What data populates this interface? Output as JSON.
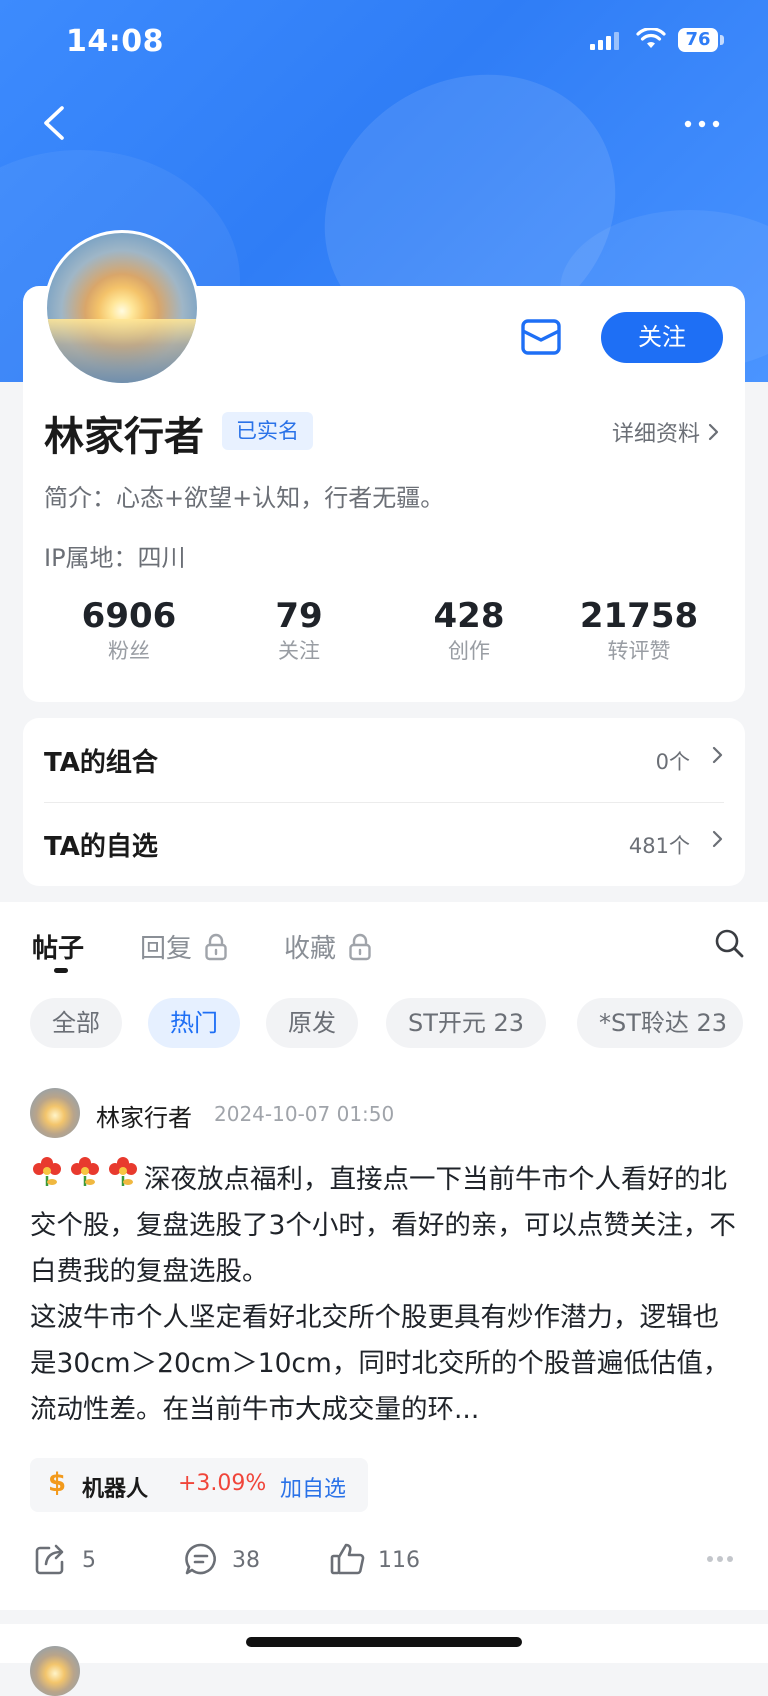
{
  "status_bar": {
    "time": "14:08",
    "battery": "76"
  },
  "profile": {
    "name": "林家行者",
    "verified_badge": "已实名",
    "detail_link": "详细资料",
    "bio": "简介：心态+欲望+认知，行者无疆。",
    "ip": "IP属地：四川",
    "follow_label": "关注",
    "stats": [
      {
        "value": "6906",
        "label": "粉丝"
      },
      {
        "value": "79",
        "label": "关注"
      },
      {
        "value": "428",
        "label": "创作"
      },
      {
        "value": "21758",
        "label": "转评赞"
      }
    ]
  },
  "lists": [
    {
      "title": "TA的组合",
      "count": "0个"
    },
    {
      "title": "TA的自选",
      "count": "481个"
    }
  ],
  "tabs": [
    {
      "label": "帖子",
      "locked": false,
      "active": true
    },
    {
      "label": "回复",
      "locked": true,
      "active": false
    },
    {
      "label": "收藏",
      "locked": true,
      "active": false
    }
  ],
  "filters": [
    {
      "label": "全部",
      "active": false
    },
    {
      "label": "热门",
      "active": true
    },
    {
      "label": "原发",
      "active": false
    },
    {
      "label": "ST开元 23",
      "active": false
    },
    {
      "label": "*ST聆达 23",
      "active": false
    }
  ],
  "post": {
    "author": "林家行者",
    "time": "2024-10-07 01:50",
    "body_line1": "深夜放点福利，直接点一下当前牛市个人看",
    "body_rest": "好的北交个股，复盘选股了3个小时，看好的亲，可以点赞关注，不白费我的复盘选股。",
    "body_para2": "这波牛市个人坚定看好北交所个股更具有炒作潜力，逻辑也是30cm＞20cm＞10cm，同时北交所的个股普遍低估值，流动性差。在当前牛市大成交量的环...",
    "stock": {
      "symbol": "$",
      "name": "机器人",
      "change": "+3.09%",
      "add_label": "加自选"
    },
    "shares": "5",
    "comments": "38",
    "likes": "116"
  },
  "colors": {
    "accent": "#1e6ff5",
    "rise": "#f0453a",
    "hero": "#2f7df6"
  }
}
